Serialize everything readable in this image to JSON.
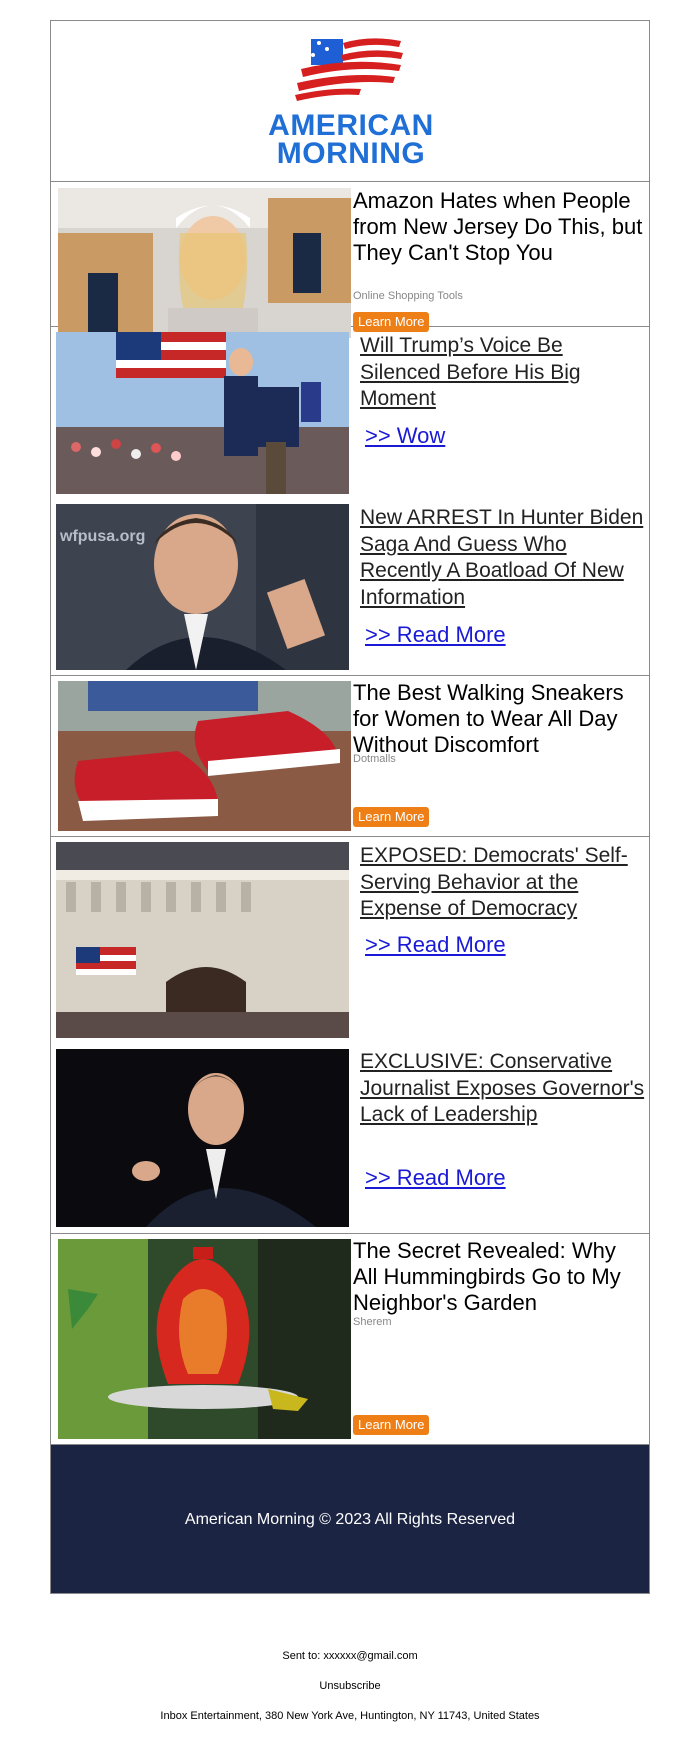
{
  "brand": {
    "line1": "AMERICAN",
    "line2": "MORNING"
  },
  "ad1": {
    "title": "Amazon Hates when People from New Jersey Do This, but They Can't Stop You",
    "source": "Online Shopping Tools",
    "button": "Learn More"
  },
  "article1": {
    "title": "Will Trump’s Voice Be Silenced Before His Big Moment",
    "more": ">> Wow"
  },
  "article2": {
    "title": "New ARREST In Hunter Biden Saga And Guess Who Recently A Boatload Of New Information",
    "more": ">> Read More",
    "image_text": "wfpusa.org"
  },
  "ad2": {
    "title": "The Best Walking Sneakers for Women to Wear All Day Without Discomfort",
    "source": "Dotmalls",
    "button": "Learn More"
  },
  "article3": {
    "title": "EXPOSED: Democrats' Self-Serving Behavior at the Expense of Democracy",
    "more": ">> Read More"
  },
  "article4": {
    "title": "EXCLUSIVE: Conservative Journalist Exposes Governor's Lack of Leadership",
    "more": ">> Read More"
  },
  "ad3": {
    "title": "The Secret Revealed: Why All Hummingbirds Go to My Neighbor's Garden",
    "source": "Sherem",
    "button": "Learn More"
  },
  "footer": {
    "copyright": "American Morning © 2023 All Rights Reserved"
  },
  "meta": {
    "sent_to": "Sent to: xxxxxx@gmail.com",
    "unsubscribe": "Unsubscribe",
    "address": "Inbox Entertainment, 380 New York Ave, Huntington, NY 11743, United States"
  },
  "colors": {
    "brand_blue": "#1f6fd6",
    "flag_red": "#d61f1f",
    "button_orange": "#ee7f17",
    "footer_navy": "#1c2443",
    "link_blue": "#1a1ad6"
  }
}
